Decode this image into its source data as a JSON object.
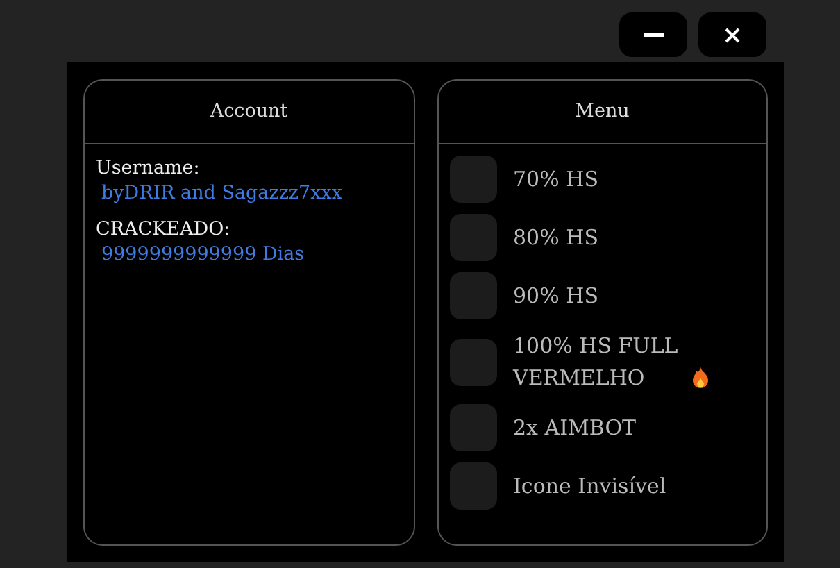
{
  "window_buttons": [
    {
      "kind": "minimize"
    },
    {
      "kind": "close"
    }
  ],
  "account": {
    "title": "Account",
    "fields": [
      {
        "label": "Username:",
        "value": "byDRIR and Sagazzz7xxx"
      },
      {
        "label": "CRACKEADO:",
        "value": "9999999999999 Dias"
      }
    ]
  },
  "menu": {
    "title": "Menu",
    "options": [
      {
        "label": "70% HS",
        "checked": false
      },
      {
        "label": "80% HS",
        "checked": false
      },
      {
        "label": "90% HS",
        "checked": false
      },
      {
        "label": "100% HS FULL VERMELHO",
        "checked": false,
        "fire": true
      },
      {
        "label": "2x AIMBOT",
        "checked": false
      },
      {
        "label": "Icone Invisível",
        "checked": false
      }
    ]
  }
}
